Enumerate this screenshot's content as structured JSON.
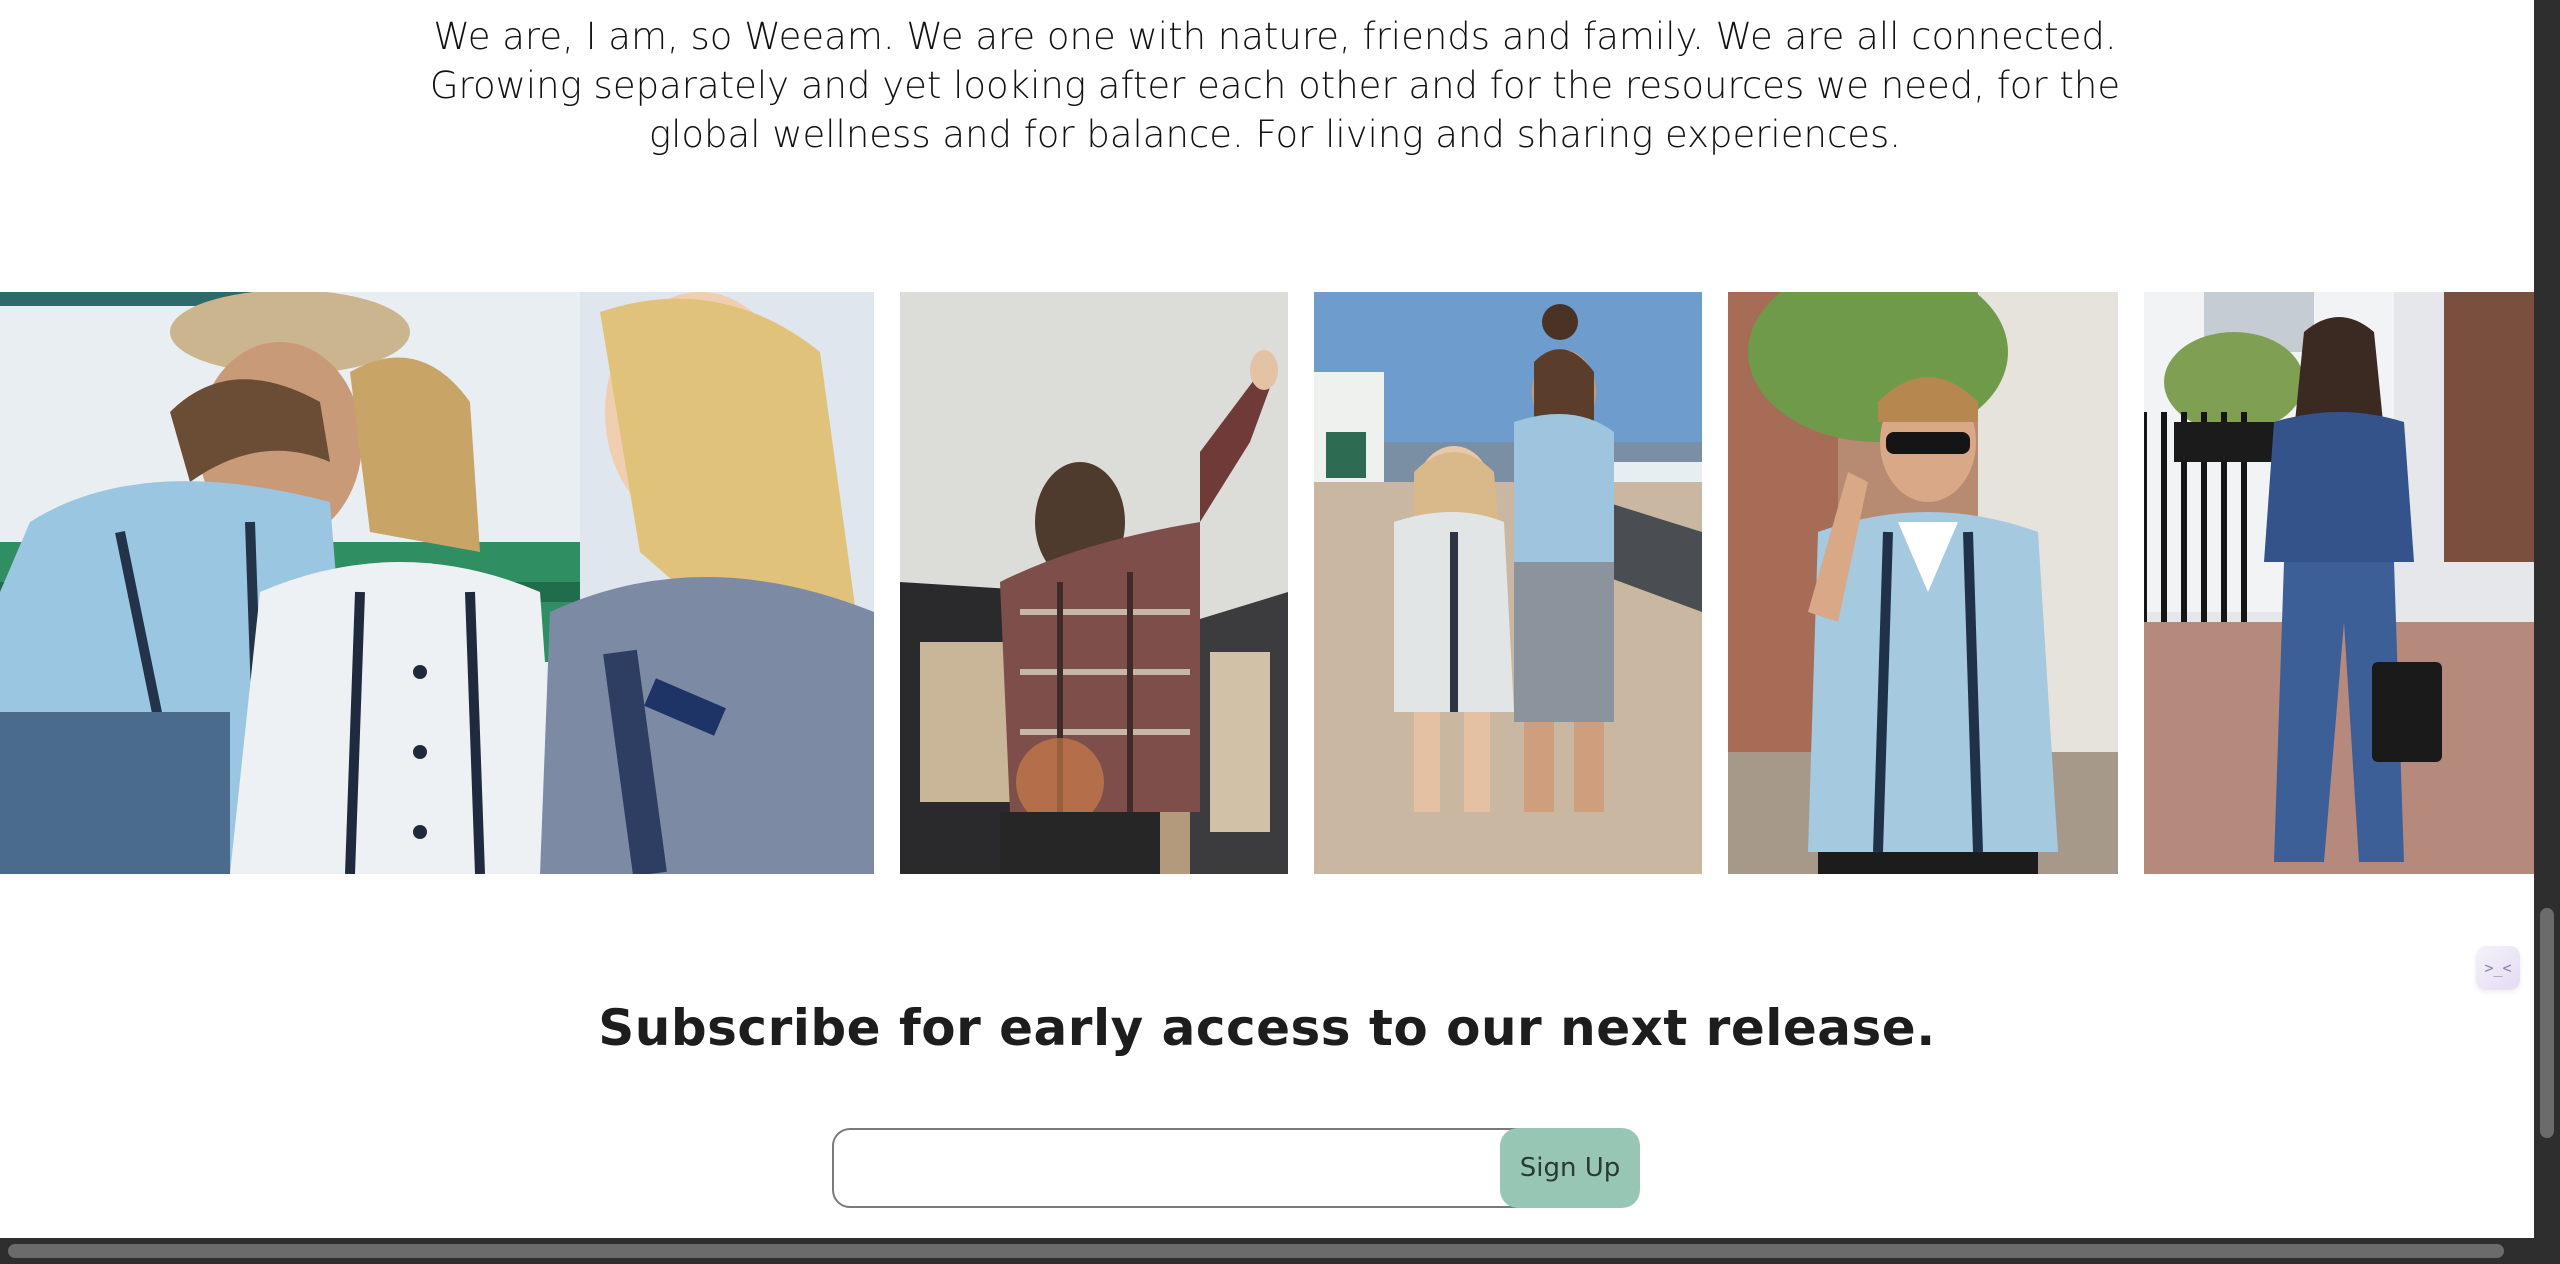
{
  "intro": {
    "lines": [
      "We are, I am, so Weeam. We are one with nature, friends and family. We are all connected.",
      "Growing separately and yet looking after each other and for the resources we need, for the",
      "global wellness and for balance. For living and sharing experiences."
    ]
  },
  "gallery": {
    "photos": [
      {
        "name": "photo-family-bench"
      },
      {
        "name": "photo-woman-car"
      },
      {
        "name": "photo-mother-daughter-beach"
      },
      {
        "name": "photo-man-sunglasses"
      },
      {
        "name": "photo-woman-denim"
      }
    ]
  },
  "subscribe": {
    "title": "Subscribe for early access to our next release.",
    "email_placeholder": "",
    "button_label": "Sign Up"
  },
  "widget": {
    "glyph": ">_<"
  },
  "colors": {
    "button": "#98c6b4",
    "text": "#1d1d1d"
  }
}
